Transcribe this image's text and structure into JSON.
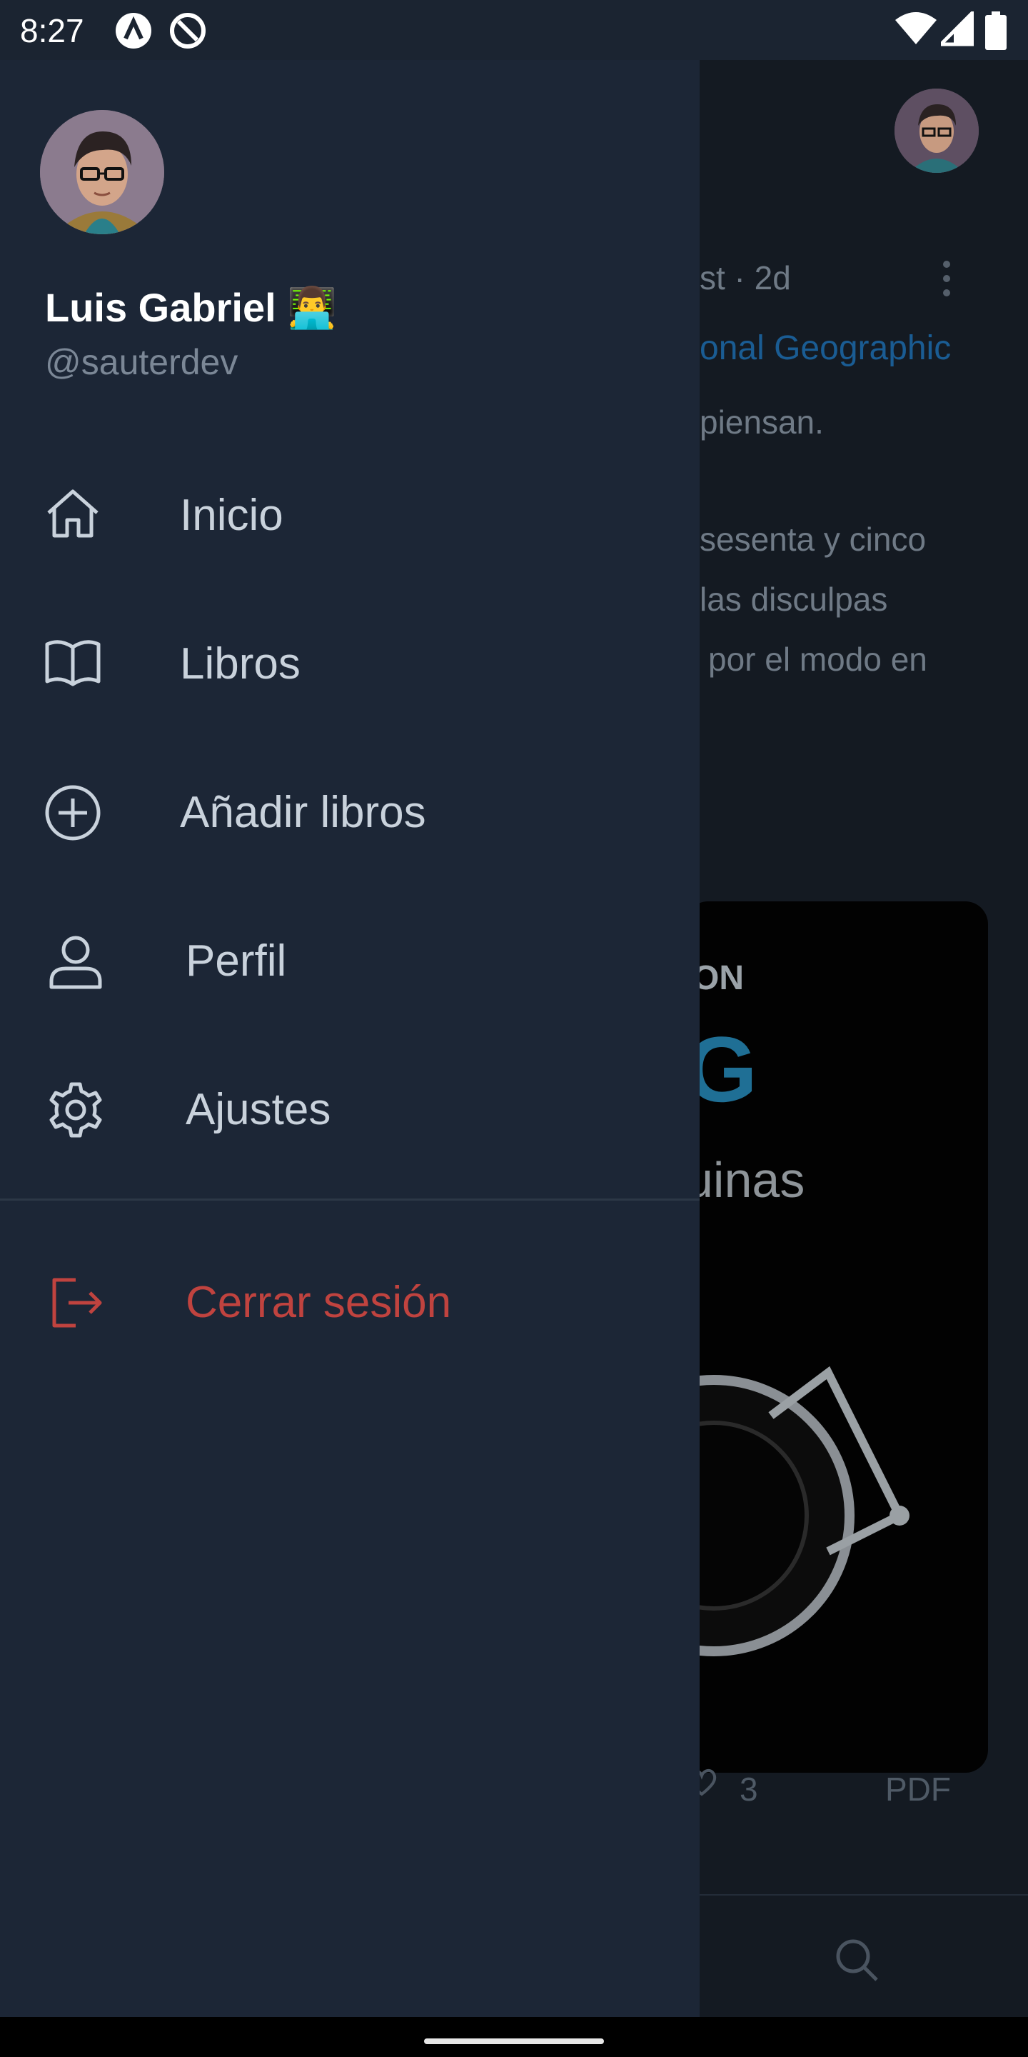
{
  "status_bar": {
    "time": "8:27"
  },
  "drawer": {
    "user": {
      "name": "Luis Gabriel 👨‍💻",
      "handle": "@sauterdev"
    },
    "menu": [
      {
        "label": "Inicio",
        "icon": "home-icon"
      },
      {
        "label": "Libros",
        "icon": "book-open-icon"
      },
      {
        "label": "Añadir libros",
        "icon": "plus-circle-icon"
      },
      {
        "label": "Perfil",
        "icon": "user-icon"
      },
      {
        "label": "Ajustes",
        "icon": "gear-icon"
      }
    ],
    "logout": {
      "label": "Cerrar sesión",
      "icon": "logout-icon"
    }
  },
  "background_post": {
    "meta": "st · 2d",
    "link": "onal Geographic",
    "line1": "piensan.",
    "line2": "sesenta y cinco",
    "line3": "las disculpas",
    "line4": "por el modo en",
    "image_text_1": "ON",
    "image_text_2": "G",
    "image_text_3": "uinas",
    "likes": "3",
    "format": "PDF"
  },
  "colors": {
    "drawer_bg": "#1c2636",
    "logout": "#c0433f",
    "link": "#1a5c93"
  }
}
